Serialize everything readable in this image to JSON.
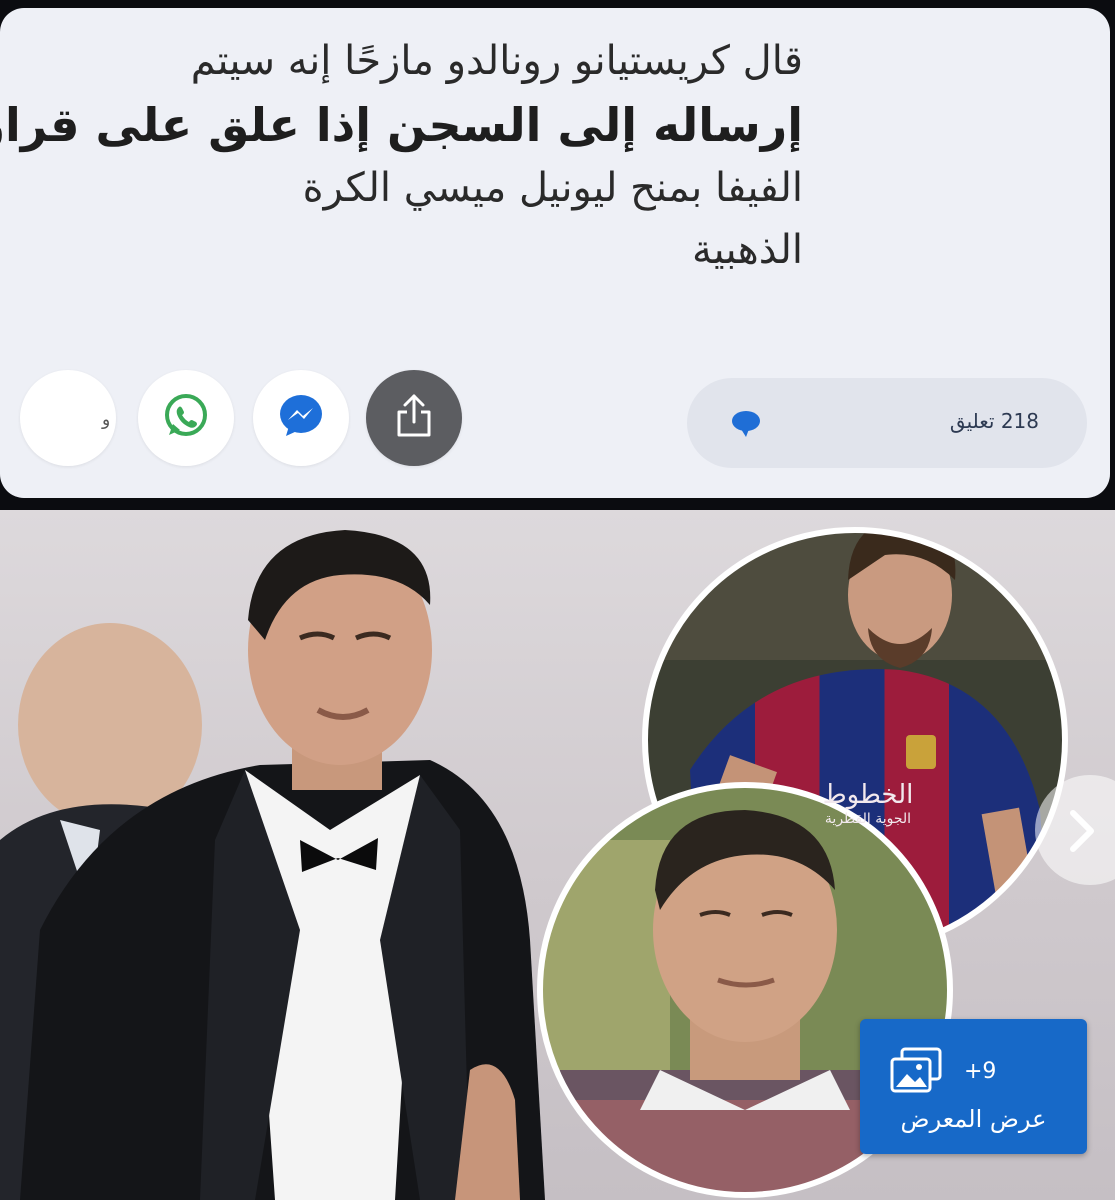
{
  "post": {
    "headline_lines": [
      "قال كريستيانو رونالدو مازحًا إنه سيتم",
      "إرساله إلى السجن إذا علق على قرار",
      "الفيفا بمنح ليونيل ميسي الكرة",
      "الذهبية"
    ]
  },
  "share_bar": {
    "more_label": "و",
    "buttons": [
      "whatsapp",
      "messenger",
      "share"
    ],
    "comments_label": "218 تعليق"
  },
  "image": {
    "watermark_line1": "الخطوط",
    "watermark_line2": "الجوية القطرية",
    "gallery_count": "+9",
    "gallery_label": "عرض المعرض"
  },
  "colors": {
    "card_bg": "#eef0f6",
    "whatsapp": "#3aa957",
    "messenger": "#1e6fd9",
    "share_btn": "#5c5d61",
    "gallery_btn": "#1769c8",
    "comment_icon": "#1f6ed6"
  },
  "icons": [
    "whatsapp-icon",
    "messenger-icon",
    "share-icon",
    "comment-icon",
    "gallery-icon",
    "chevron-right-icon"
  ]
}
